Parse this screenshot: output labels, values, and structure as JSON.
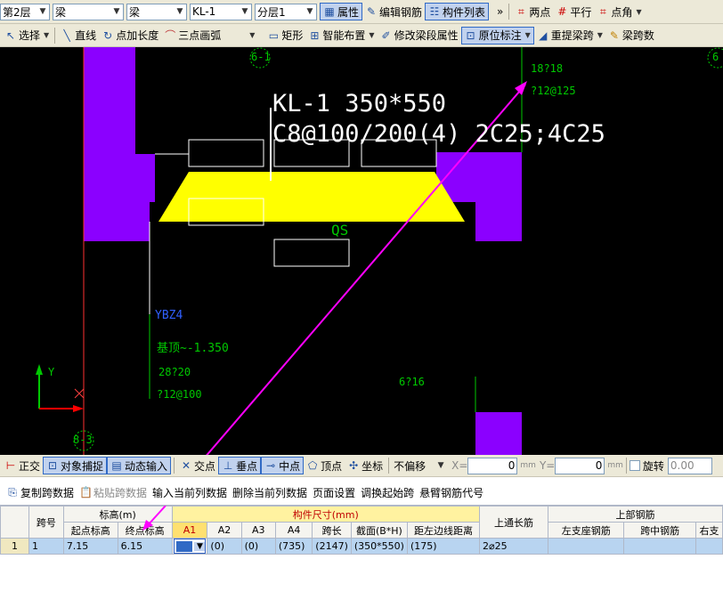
{
  "toolbar1": {
    "floor": "第2层",
    "type1": "梁",
    "type2": "梁",
    "component": "KL-1",
    "sublayer": "分层1",
    "buttons": [
      "属性",
      "编辑钢筋",
      "构件列表"
    ],
    "more": "»",
    "right_buttons": [
      "两点",
      "平行",
      "点角"
    ]
  },
  "toolbar2": {
    "items": [
      "选择",
      "直线",
      "点加长度",
      "三点画弧",
      "矩形",
      "智能布置",
      "修改梁段属性",
      "原位标注",
      "重提梁跨",
      "梁跨数"
    ]
  },
  "canvas": {
    "beam_label": "KL-1 350*550",
    "beam_stirrup": "C8@100/200(4) 2C25;4C25",
    "axis_top_left": "6-1",
    "axis_top_right": "6",
    "axis_bottom_left": "8-3",
    "rebar_top_right_1": "18?18",
    "rebar_top_right_2": "?12@125",
    "qs_label": "QS",
    "ybz_label": "YBZ4",
    "base_elev": "基顶~-1.350",
    "rebar_left_1": "28?20",
    "rebar_left_2": "?12@100",
    "rebar_mid": "6?16",
    "axis_y": "Y",
    "colors": {
      "column": "#8b00ff",
      "beam": "#ffff00",
      "text_green": "#00c800",
      "arrow": "#ff00ff"
    }
  },
  "snapbar": {
    "items": [
      "正交",
      "对象捕捉",
      "动态输入",
      "交点",
      "垂点",
      "中点",
      "顶点",
      "坐标"
    ],
    "mode": "不偏移",
    "x_label": "X=",
    "x_value": "0",
    "y_label": "Y=",
    "y_value": "0",
    "unit": "mm",
    "rotate_label": "旋转",
    "rotate_value": "0.00"
  },
  "gridtools": {
    "items": [
      "复制跨数据",
      "粘贴跨数据",
      "输入当前列数据",
      "删除当前列数据",
      "页面设置",
      "调换起始跨",
      "悬臂钢筋代号"
    ]
  },
  "grid": {
    "h_span": "跨号",
    "h_elev": "标高(m)",
    "h_start": "起点标高",
    "h_end": "终点标高",
    "h_size": "构件尺寸(mm)",
    "h_cols": [
      "A1",
      "A2",
      "A3",
      "A4",
      "跨长",
      "截面(B*H)",
      "距左边线距离"
    ],
    "h_topbar": "上通长筋",
    "h_upper": "上部钢筋",
    "h_upper_cols": [
      "左支座钢筋",
      "跨中钢筋",
      "右支"
    ],
    "row": {
      "idx": "1",
      "span": "1",
      "start": "7.15",
      "end": "6.15",
      "a1": "",
      "a2": "(0)",
      "a3": "(0)",
      "a4": "(735)",
      "len": "(2147)",
      "section": "(350*550)",
      "dist": "(175)",
      "topbar": "2⌀25"
    }
  }
}
